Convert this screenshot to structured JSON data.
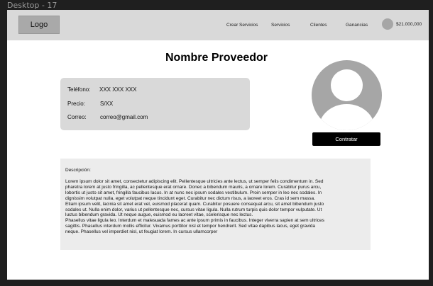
{
  "frame": {
    "label": "Desktop - 17"
  },
  "header": {
    "logo": "Logo",
    "nav": [
      "Crear Servicios",
      "Servicios",
      "Clientes",
      "Ganancias"
    ],
    "balance": "$21.000,000"
  },
  "main": {
    "title": "Nombre Proveedor",
    "info": [
      {
        "label": "Teléfono:",
        "value": "XXX XXX XXX"
      },
      {
        "label": "Precio:",
        "value": "S/XX"
      },
      {
        "label": "Correo:",
        "value": "correo@gmail.com"
      }
    ],
    "hire_button": "Contratar",
    "description_label": "Descripción:",
    "description_text": "Lorem ipsum dolor sit amet, consectetur adipiscing elit. Pellentesque ultricies ante lectus, ut semper felis condimentum in. Sed\npharetra lorem at justo fringilla, ac pellentesque erat ornare. Donec a bibendum mauris, a ornare lorem. Curabitur purus arcu,\nlobortis ut justo sit amet, fringilla faucibus lacus. In at nunc nec ipsum sodales vestibulum. Proin semper in leo nec sodales. In\ndignissim volutpat nulla, eget volutpat neque tincidunt eget. Curabitur nec dictum risus, a laoreet eros. Cras id sem massa.\nEtiam ipsum velit, lacinia sit amet erat vel, euismod placerat quam. Curabitur posuere consequat arcu, sit amet bibendum justo\nsodales ut. Nulla enim dolor, varius ut pellentesque nec, cursus vitae ligula. Nulla rutrum turpis quis dolor tempor vulputate. Ut\nluctus bibendum gravida. Ut neque augue, euismod eu laoreet vitae, scelerisque nec lectus.\nPhasellus vitae ligula leo. Interdum et malesuada fames ac ante ipsum primis in faucibus. Integer viverra sapien at sem ultrices\nsagittis. Phasellus interdum mollis efficitur. Vivamus porttitor nisl et tempor hendrerit. Sed vitae dapibus lacus, eget gravida\nneque. Phasellus vel imperdiet nisl, ut feugiat lorem. In cursus ullamcorper"
  },
  "icons": {
    "user_avatar": "user-avatar-icon",
    "profile_placeholder": "profile-placeholder-icon"
  },
  "colors": {
    "header_bg": "#d9d9d9",
    "card_bg": "#d9d9d9",
    "description_bg": "#ececec",
    "button_bg": "#000000",
    "placeholder_gray": "#a6a6a6"
  }
}
